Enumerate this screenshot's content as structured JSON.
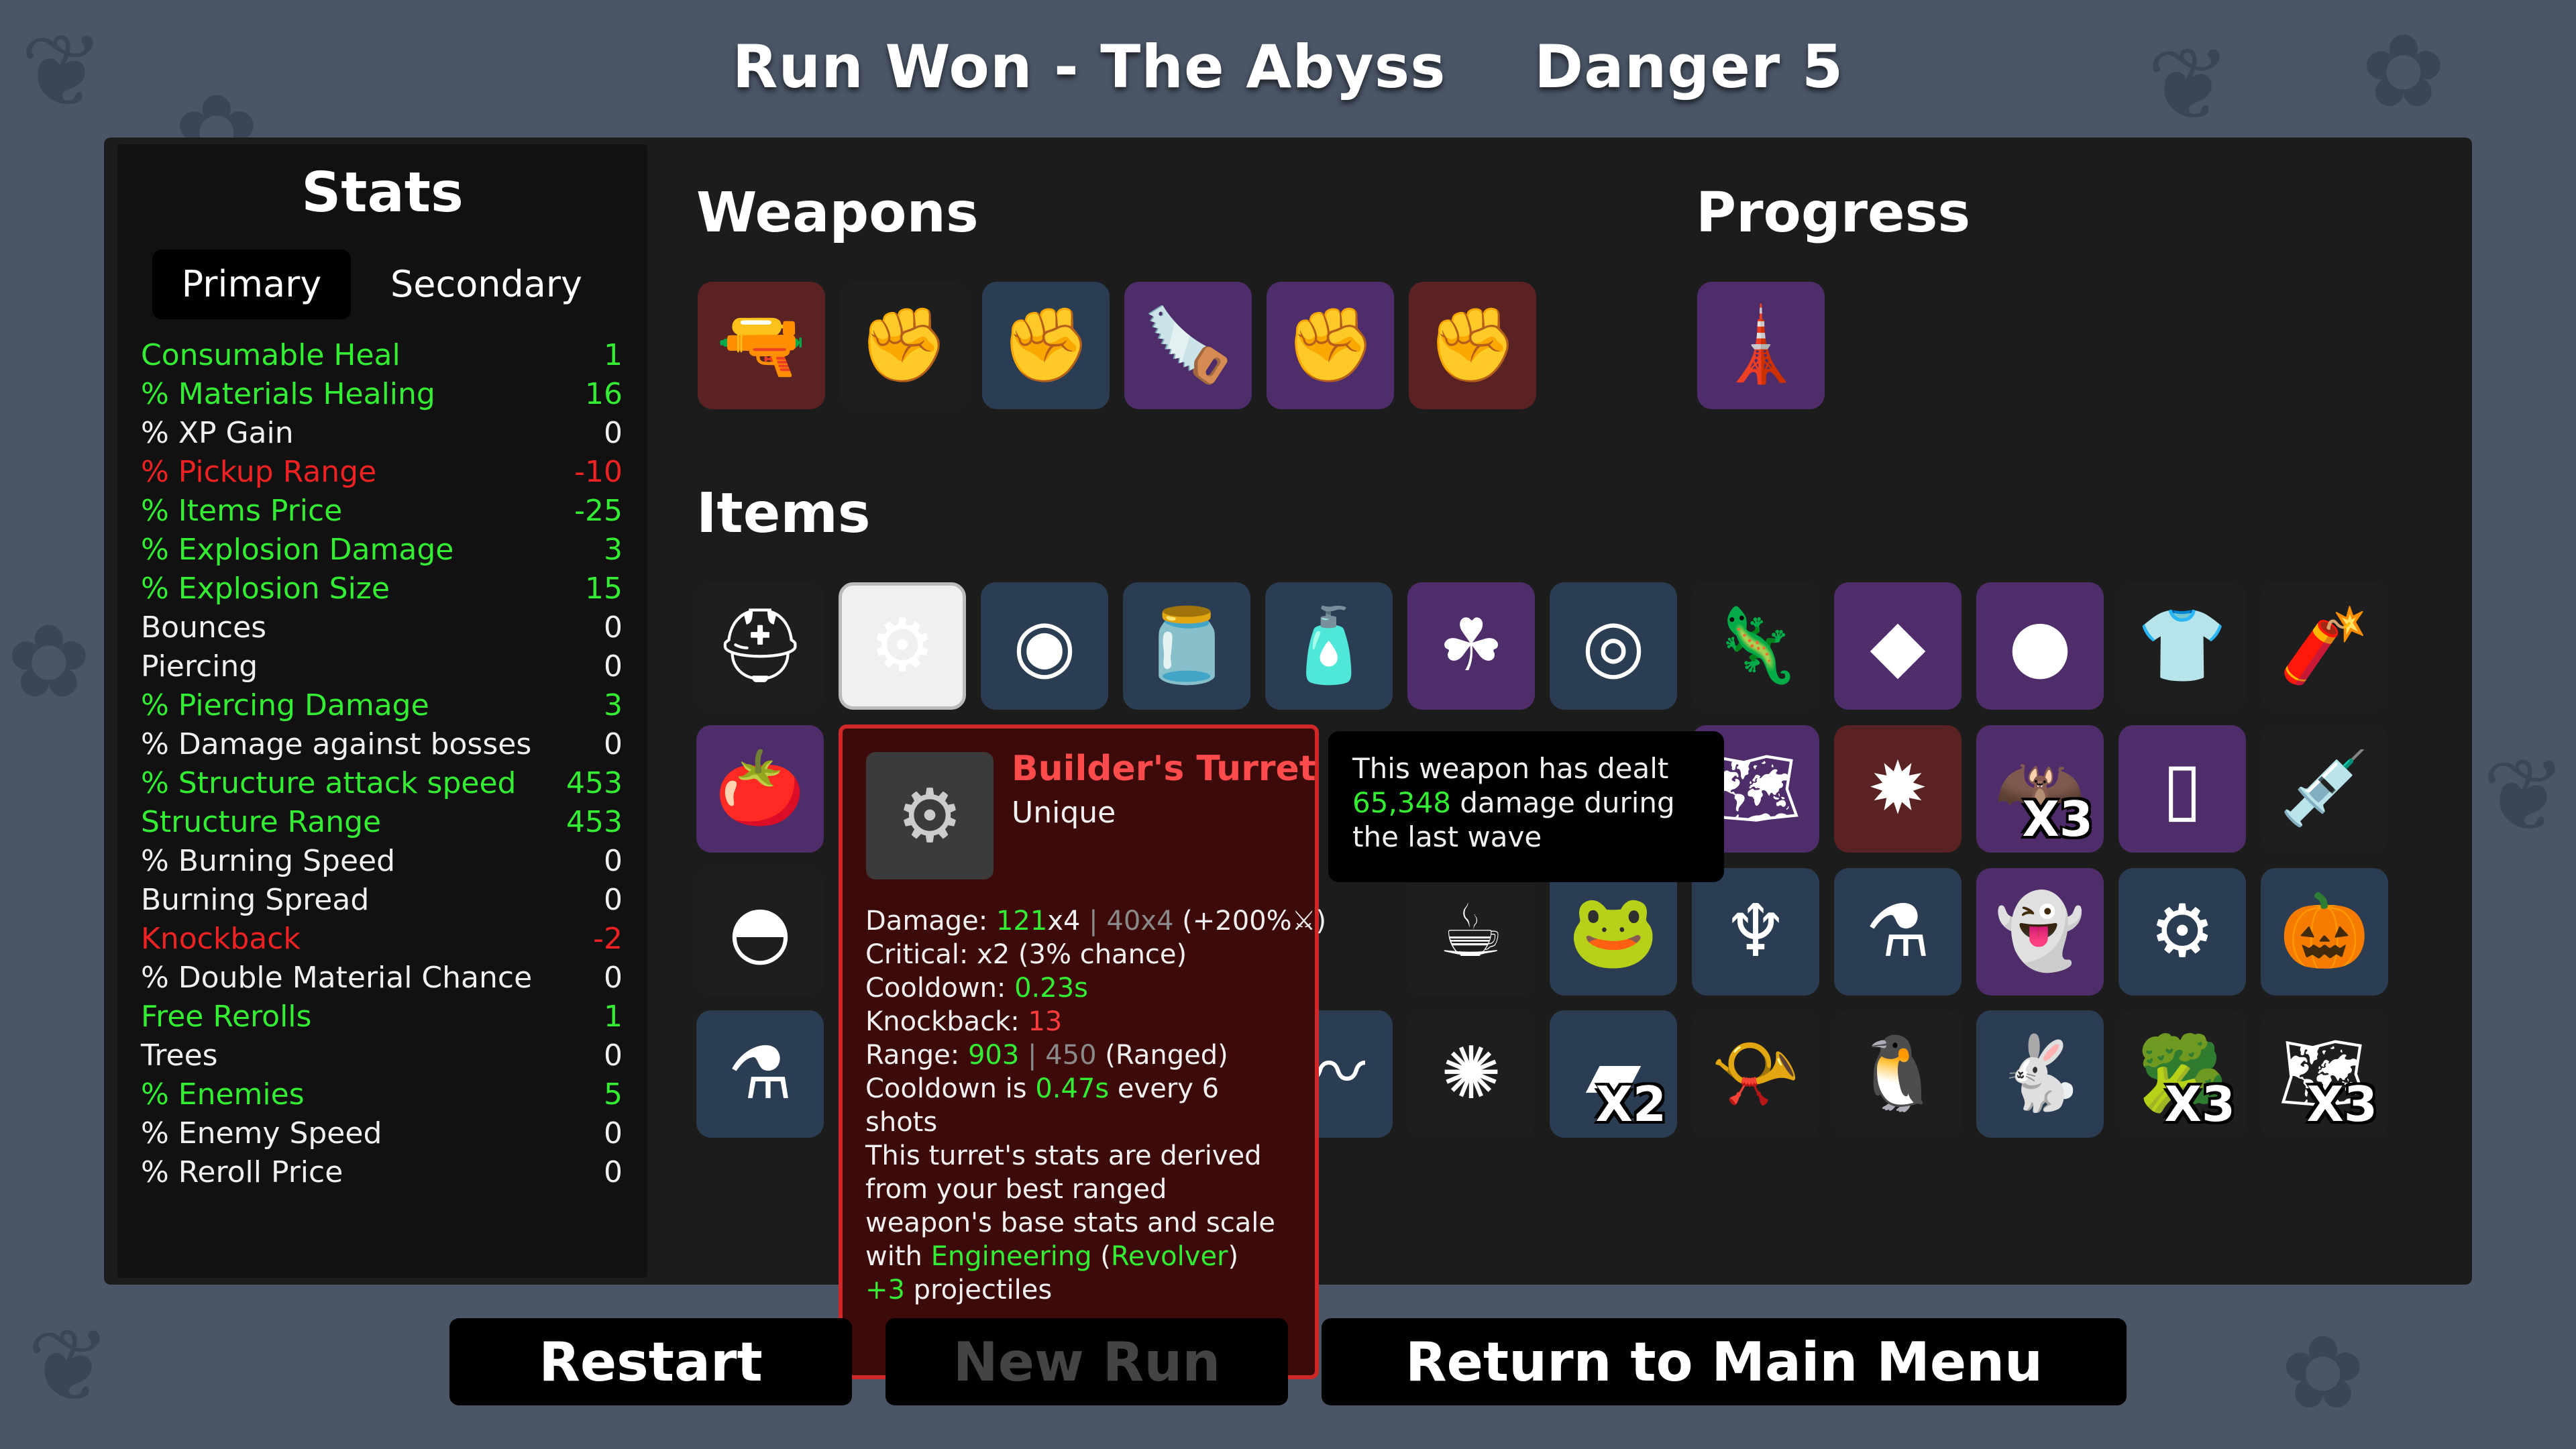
{
  "header": {
    "run_result": "Run Won - The Abyss",
    "danger": "Danger 5"
  },
  "stats": {
    "title": "Stats",
    "tabs": [
      {
        "label": "Primary",
        "active": true
      },
      {
        "label": "Secondary",
        "active": false
      }
    ],
    "rows": [
      {
        "label": "Consumable Heal",
        "value": "1",
        "color": "green"
      },
      {
        "label": "% Materials Healing",
        "value": "16",
        "color": "green"
      },
      {
        "label": "% XP Gain",
        "value": "0",
        "color": "white"
      },
      {
        "label": "% Pickup Range",
        "value": "-10",
        "color": "red"
      },
      {
        "label": "% Items Price",
        "value": "-25",
        "color": "green"
      },
      {
        "label": "% Explosion Damage",
        "value": "3",
        "color": "green"
      },
      {
        "label": "% Explosion Size",
        "value": "15",
        "color": "green"
      },
      {
        "label": "Bounces",
        "value": "0",
        "color": "white"
      },
      {
        "label": "Piercing",
        "value": "0",
        "color": "white"
      },
      {
        "label": "% Piercing Damage",
        "value": "3",
        "color": "green"
      },
      {
        "label": "% Damage against bosses",
        "value": "0",
        "color": "white"
      },
      {
        "label": "% Structure attack speed",
        "value": "453",
        "color": "green"
      },
      {
        "label": "Structure Range",
        "value": "453",
        "color": "green"
      },
      {
        "label": "% Burning Speed",
        "value": "0",
        "color": "white"
      },
      {
        "label": "Burning Spread",
        "value": "0",
        "color": "white"
      },
      {
        "label": "Knockback",
        "value": "-2",
        "color": "red"
      },
      {
        "label": "% Double Material Chance",
        "value": "0",
        "color": "white"
      },
      {
        "label": "Free Rerolls",
        "value": "1",
        "color": "green"
      },
      {
        "label": "Trees",
        "value": "0",
        "color": "white"
      },
      {
        "label": "% Enemies",
        "value": "5",
        "color": "green"
      },
      {
        "label": "% Enemy Speed",
        "value": "0",
        "color": "white"
      },
      {
        "label": "% Reroll Price",
        "value": "0",
        "color": "white"
      }
    ]
  },
  "weapons": {
    "title": "Weapons",
    "slots": [
      {
        "icon": "revolver-icon",
        "tier": "red"
      },
      {
        "icon": "gauntlet-icon",
        "tier": "dark"
      },
      {
        "icon": "gauntlet-icon",
        "tier": "blue"
      },
      {
        "icon": "chainsaw-icon",
        "tier": "purple"
      },
      {
        "icon": "gauntlet-icon",
        "tier": "purple"
      },
      {
        "icon": "gauntlet-icon",
        "tier": "red"
      }
    ]
  },
  "progress": {
    "title": "Progress",
    "slots": [
      {
        "icon": "lighthouse-icon",
        "tier": "purple"
      }
    ]
  },
  "items": {
    "title": "Items",
    "rows": [
      [
        {
          "icon": "hardhat-icon",
          "tier": "dark"
        },
        {
          "icon": "builders-turret-icon",
          "tier": "white"
        },
        {
          "icon": "goggles-icon",
          "tier": "blue"
        },
        {
          "icon": "jar-icon",
          "tier": "blue"
        },
        {
          "icon": "ketchup-icon",
          "tier": "blue"
        },
        {
          "icon": "clover-icon",
          "tier": "purple"
        },
        {
          "icon": "target-ring-icon",
          "tier": "blue"
        },
        {
          "icon": "lizard-icon",
          "tier": "dark"
        },
        {
          "icon": "crystal-icon",
          "tier": "purple"
        },
        {
          "icon": "rock-icon",
          "tier": "purple"
        },
        {
          "icon": "flannel-shirt-icon",
          "tier": "dark"
        },
        {
          "icon": "dynamite-icon",
          "tier": "dark"
        }
      ],
      [
        {
          "icon": "tomato-icon",
          "tier": "purple"
        },
        {
          "icon": "map-icon",
          "tier": "purple",
          "count": ""
        },
        {
          "icon": "star-gear-icon",
          "tier": "red",
          "count": ""
        },
        {
          "icon": "bat-icon",
          "tier": "purple",
          "count": "X3"
        },
        {
          "icon": "mirror-icon",
          "tier": "purple",
          "count": ""
        },
        {
          "icon": "syringe-icon",
          "tier": "dark",
          "count": ""
        }
      ],
      [
        {
          "icon": "helmet-icon",
          "tier": "dark"
        },
        {
          "icon": "mug-icon",
          "tier": "dark",
          "count": ""
        },
        {
          "icon": "frog-icon",
          "tier": "blue",
          "count": ""
        },
        {
          "icon": "coral-icon",
          "tier": "blue",
          "count": ""
        },
        {
          "icon": "potion-icon",
          "tier": "blue",
          "count": ""
        },
        {
          "icon": "ghost-icon",
          "tier": "purple",
          "count": ""
        },
        {
          "icon": "cog-icon",
          "tier": "blue",
          "count": ""
        },
        {
          "icon": "pumpkin-icon",
          "tier": "blue",
          "count": ""
        }
      ],
      [
        {
          "icon": "flask-icon",
          "tier": "blue"
        },
        {
          "icon": "worm-icon",
          "tier": "blue",
          "count": ""
        },
        {
          "icon": "spore-icon",
          "tier": "dark",
          "count": ""
        },
        {
          "icon": "block-icon",
          "tier": "blue",
          "count": "X2"
        },
        {
          "icon": "whistle-icon",
          "tier": "dark",
          "count": ""
        },
        {
          "icon": "penguin-icon",
          "tier": "dark",
          "count": ""
        },
        {
          "icon": "rabbit-icon",
          "tier": "blue",
          "count": ""
        },
        {
          "icon": "broccoli-icon",
          "tier": "dark",
          "count": "X3"
        },
        {
          "icon": "treasure-map-icon",
          "tier": "dark",
          "count": "X3"
        }
      ]
    ]
  },
  "tooltip": {
    "name": "Builder's Turret",
    "rarity": "Unique",
    "damage_label": "Damage: ",
    "damage_value": "121",
    "damage_mult": "x4",
    "damage_sep": " | ",
    "damage_base": "40x4",
    "damage_bonus": " (+200%",
    "critical": "Critical: x2 (3% chance)",
    "cooldown_label": "Cooldown: ",
    "cooldown_value": "0.23s",
    "knockback_label": "Knockback: ",
    "knockback_value": "13",
    "range_label": "Range: ",
    "range_value": "903",
    "range_sep": " | ",
    "range_base": "450",
    "range_type": " (Ranged)",
    "cooldown_note_a": "Cooldown is ",
    "cooldown_note_value": "0.47s",
    "cooldown_note_b": " every 6",
    "cooldown_note_c": "shots",
    "desc_a": "This turret's stats are derived from your best ranged weapon's base stats and scale with ",
    "desc_highlight1": "Engineering",
    "desc_b": " (",
    "desc_highlight2": "Revolver",
    "desc_c": ")",
    "proj_value": "+3",
    "proj_label": " projectiles"
  },
  "popup": {
    "line1": "This weapon has dealt",
    "damage_value": "65,348",
    "line2_rest": " damage during",
    "line3": "the last wave"
  },
  "buttons": {
    "restart": "Restart",
    "new_run": "New Run",
    "return": "Return to Main Menu"
  }
}
